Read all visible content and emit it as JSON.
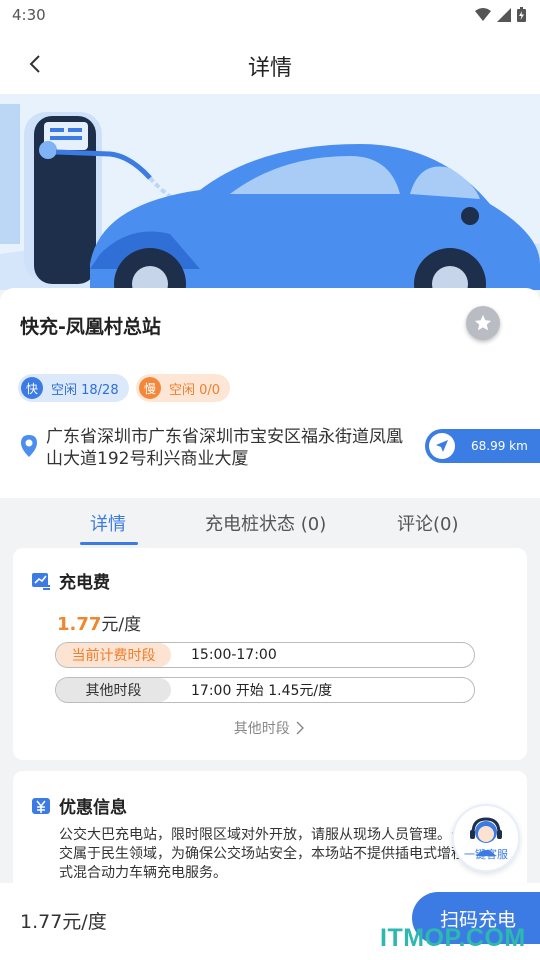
{
  "status_bar": {
    "time": "4:30"
  },
  "header": {
    "title": "详情"
  },
  "station": {
    "name": "快充-凤凰村总站",
    "fast_tag": {
      "icon_char": "快",
      "text": "空闲 18/28"
    },
    "slow_tag": {
      "icon_char": "慢",
      "text": "空闲 0/0"
    },
    "address": "广东省深圳市广东省深圳市宝安区福永街道凤凰山大道192号利兴商业大厦",
    "distance": "68.99 km"
  },
  "tabs": [
    {
      "label": "详情",
      "active": true
    },
    {
      "label": "充电桩状态 (0)",
      "active": false
    },
    {
      "label": "评论(0)",
      "active": false
    }
  ],
  "fee": {
    "heading": "充电费",
    "price_value": "1.77",
    "price_unit": "元/度",
    "current_label": "当前计费时段",
    "current_value": "15:00-17:00",
    "other_label": "其他时段",
    "other_value": "17:00 开始 1.45元/度",
    "more_link": "其他时段"
  },
  "promo": {
    "heading": "优惠信息",
    "text": "公交大巴充电站，限时限区域对外开放，请服从现场人员管理。公交属于民生领域，为确保公交场站安全，本场站不提供插电式增程式混合动力车辆充电服务。"
  },
  "service": {
    "label": "一键客服"
  },
  "bottom": {
    "price": "1.77元/度",
    "scan_button": "扫码充电"
  },
  "watermark": "ITMOP.COM",
  "colors": {
    "accent": "#3b7be3",
    "orange": "#f07f2e",
    "teal_watermark": "#2eb8b0"
  }
}
